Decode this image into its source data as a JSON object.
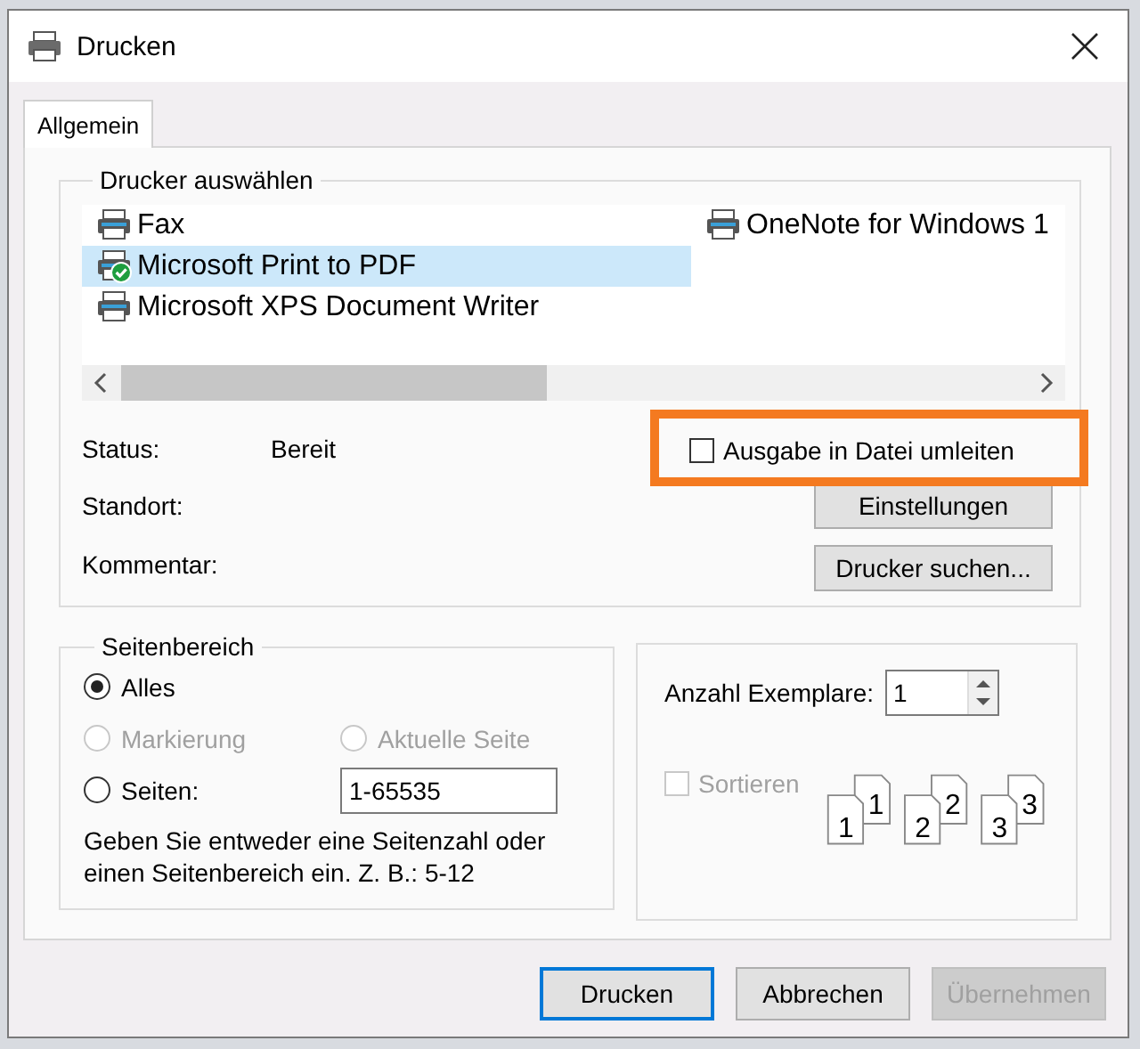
{
  "window": {
    "title": "Drucken"
  },
  "tabs": [
    {
      "label": "Allgemein",
      "selected": true
    }
  ],
  "printer_group": {
    "title": "Drucker auswählen",
    "printers": [
      {
        "name": "Fax",
        "selected": false,
        "is_default": false
      },
      {
        "name": "Microsoft Print to PDF",
        "selected": true,
        "is_default": true
      },
      {
        "name": "Microsoft XPS Document Writer",
        "selected": false,
        "is_default": false
      },
      {
        "name": "OneNote for Windows 1",
        "selected": false,
        "is_default": false
      }
    ],
    "info": [
      {
        "label": "Status:",
        "value": "Bereit"
      },
      {
        "label": "Standort:"
      },
      {
        "label": "Kommentar:"
      }
    ],
    "print_to_file": {
      "label": "Ausgabe in Datei umleiten",
      "checked": false,
      "highlighted": true
    },
    "buttons": [
      "Einstellungen",
      "Drucker suchen..."
    ]
  },
  "page_range": {
    "title": "Seitenbereich",
    "options": [
      {
        "label": "Alles",
        "selected": true,
        "disabled": false
      },
      {
        "label": "Markierung",
        "selected": false,
        "disabled": true
      },
      {
        "label": "Aktuelle Seite",
        "selected": false,
        "disabled": true
      },
      {
        "label": "Seiten:",
        "selected": false,
        "disabled": false
      }
    ],
    "pages_value": "1-65535",
    "hint": "Geben Sie entweder eine Seitenzahl oder einen Seitenbereich ein. Z. B.: 5-12"
  },
  "copies": {
    "label": "Anzahl Exemplare:",
    "value": "1",
    "collate": {
      "label": "Sortieren",
      "checked": false,
      "disabled": true
    },
    "collate_pages": [
      {
        "back": "1",
        "front": "1"
      },
      {
        "back": "2",
        "front": "2"
      },
      {
        "back": "3",
        "front": "3"
      }
    ]
  },
  "buttons": [
    {
      "label": "Drucken",
      "default": true,
      "disabled": false
    },
    {
      "label": "Abbrechen",
      "default": false,
      "disabled": false
    },
    {
      "label": "Übernehmen",
      "default": false,
      "disabled": true
    }
  ]
}
